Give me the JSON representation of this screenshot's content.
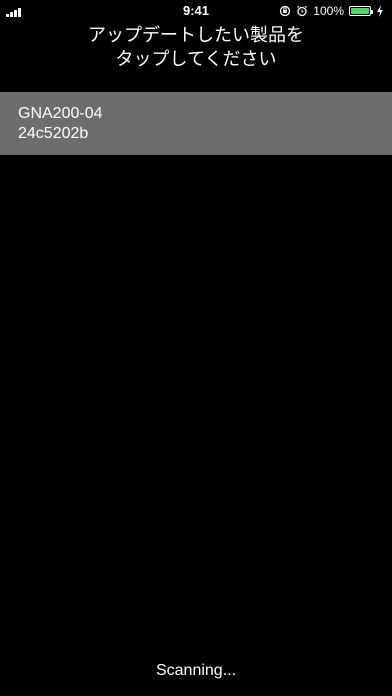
{
  "status_bar": {
    "time": "9:41",
    "battery_percent_label": "100%",
    "battery_level": 1.0,
    "battery_color": "#4cd964",
    "icons": [
      "signal-icon",
      "lock-rotation-icon",
      "alarm-icon",
      "battery-icon",
      "charging-icon"
    ]
  },
  "header": {
    "title_line1": "アップデートしたい製品を",
    "title_line2": "タップしてください"
  },
  "devices": [
    {
      "name": "GNA200-04",
      "id": "24c5202b"
    }
  ],
  "footer": {
    "status": "Scanning..."
  },
  "colors": {
    "background": "#000000",
    "row_background": "#6d6d6d",
    "text": "#ffffff"
  }
}
